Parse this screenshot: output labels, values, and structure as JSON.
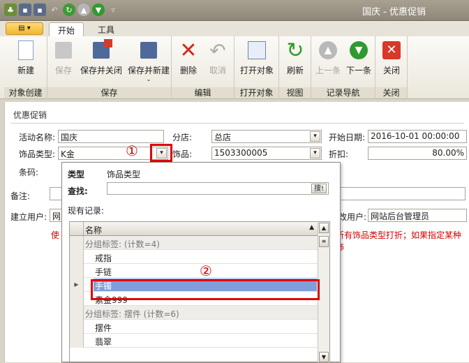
{
  "window": {
    "title": "国庆 - 优惠促销"
  },
  "tabs": {
    "home": "开始",
    "tools": "工具"
  },
  "ribbon": {
    "groups": {
      "create": "对象创建",
      "save": "保存",
      "edit": "编辑",
      "open": "打开对象",
      "view": "视图",
      "nav": "记录导航",
      "close": "关闭"
    },
    "buttons": {
      "new": "新建",
      "save": "保存",
      "save_close": "保存并关闭",
      "save_new": "保存并新建",
      "delete": "删除",
      "cancel": "取消",
      "open": "打开对象",
      "refresh": "刷新",
      "prev": "上一条",
      "next": "下一条",
      "close": "关闭"
    }
  },
  "form": {
    "section": "优惠促销",
    "activity_label": "活动名称:",
    "activity_value": "国庆",
    "branch_label": "分店:",
    "branch_value": "总店",
    "start_label": "开始日期:",
    "start_value": "2016-10-01 00:00:00",
    "type_label": "饰品类型:",
    "type_value": "K金",
    "item_label": "饰品:",
    "item_value": "1503300005",
    "discount_label": "折扣:",
    "discount_value": "80.00%",
    "barcode_label": "条码:",
    "note_label": "备注:",
    "creator_label": "建立用户:",
    "creator_value": "网",
    "modifier_label": "改用户:",
    "modifier_value": "网站后台管理员",
    "hint_left": "使",
    "hint_right": "所有饰品类型打折；如果指定某种饰"
  },
  "popup": {
    "col_type": "类型",
    "col_type_value": "饰品类型",
    "search_label": "查找:",
    "search_button": "搜!",
    "records_label": "现有记录:",
    "header": "名称",
    "rows": [
      {
        "kind": "group",
        "text": "分组标签: (计数=4)"
      },
      {
        "kind": "item",
        "text": "戒指"
      },
      {
        "kind": "item",
        "text": "手链"
      },
      {
        "kind": "item",
        "text": "手镯"
      },
      {
        "kind": "item",
        "text": "素金999"
      },
      {
        "kind": "group",
        "text": "分组标签: 摆件 (计数=6)"
      },
      {
        "kind": "item",
        "text": "摆件"
      },
      {
        "kind": "item",
        "text": "翡翠"
      }
    ]
  },
  "annotations": {
    "one": "①",
    "two": "②"
  }
}
